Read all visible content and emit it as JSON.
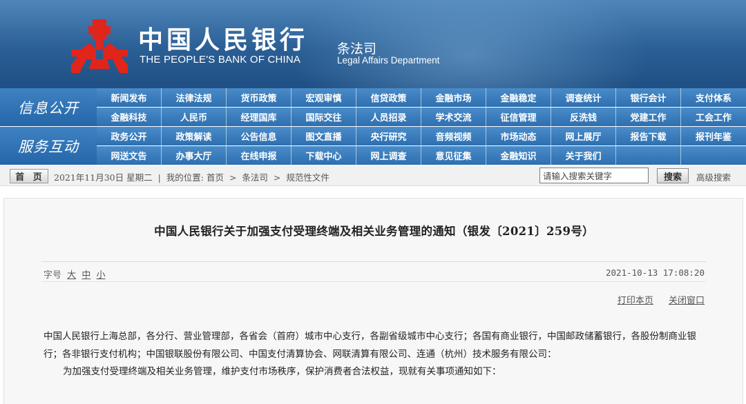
{
  "header": {
    "bank_name_cn": "中国人民银行",
    "bank_name_en": "THE PEOPLE'S BANK OF CHINA",
    "dept_cn": "条法司",
    "dept_en": "Legal Affairs Department",
    "logo_icon": "pboc-logo-icon",
    "colors": {
      "banner": "#2a5f95",
      "logo_red": "#e1251b",
      "nav": "#2d6fb0"
    }
  },
  "nav": {
    "group1_label": "信息公开",
    "group1_row1": [
      "新闻发布",
      "法律法规",
      "货币政策",
      "宏观审慎",
      "信贷政策",
      "金融市场",
      "金融稳定",
      "调查统计",
      "银行会计",
      "支付体系"
    ],
    "group1_row2": [
      "金融科技",
      "人民币",
      "经理国库",
      "国际交往",
      "人员招录",
      "学术交流",
      "征信管理",
      "反洗钱",
      "党建工作",
      "工会工作"
    ],
    "group2_label": "服务互动",
    "group2_row1": [
      "政务公开",
      "政策解读",
      "公告信息",
      "图文直播",
      "央行研究",
      "音频视频",
      "市场动态",
      "网上展厅",
      "报告下载",
      "报刊年鉴"
    ],
    "group2_row2": [
      "网送文告",
      "办事大厅",
      "在线申报",
      "下载中心",
      "网上调查",
      "意见征集",
      "金融知识",
      "关于我们",
      "",
      ""
    ]
  },
  "statusbar": {
    "home_label": "首 页",
    "date": "2021年11月30日 星期二",
    "separator": "|",
    "location_label": "我的位置:",
    "crumbs": [
      "首页",
      "条法司",
      "规范性文件"
    ],
    "crumb_sep": ">",
    "search_placeholder": "请输入搜索关键字",
    "search_label": "搜索",
    "advanced_search": "高级搜索"
  },
  "article": {
    "title": "中国人民银行关于加强支付受理终端及相关业务管理的通知（银发〔2021〕259号）",
    "font_size_label": "字号",
    "font_sizes": [
      "大",
      "中",
      "小"
    ],
    "published": "2021-10-13 17:08:20",
    "print_label": "打印本页",
    "close_label": "关闭窗口",
    "addressee": "中国人民银行上海总部，各分行、营业管理部，各省会（首府）城市中心支行，各副省级城市中心支行；各国有商业银行，中国邮政储蓄银行，各股份制商业银行；各非银行支付机构；中国银联股份有限公司、中国支付清算协会、网联清算有限公司、连通（杭州）技术服务有限公司：",
    "intro": "为加强支付受理终端及相关业务管理，维护支付市场秩序，保护消费者合法权益，现就有关事项通知如下："
  }
}
